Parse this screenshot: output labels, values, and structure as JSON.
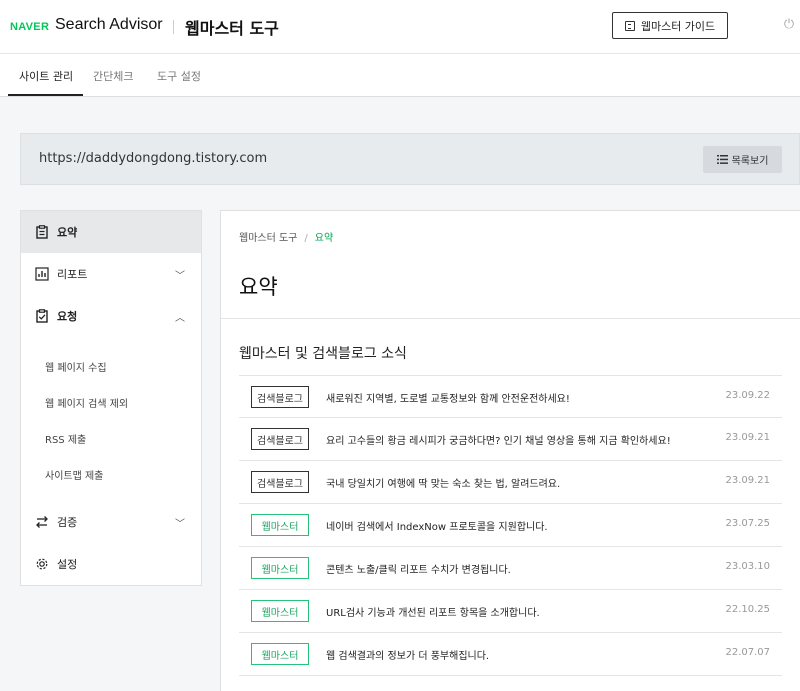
{
  "header": {
    "brand": "NAVER",
    "product": "Search Advisor",
    "tool_title": "웹마스터 도구",
    "guide_button": "웹마스터 가이드",
    "power_icon": "power-icon"
  },
  "tabs": [
    {
      "label": "사이트 관리",
      "active": true
    },
    {
      "label": "간단체크",
      "active": false
    },
    {
      "label": "도구 설정",
      "active": false
    }
  ],
  "site": {
    "url": "https://daddydongdong.tistory.com",
    "list_button": "목록보기"
  },
  "sidebar": {
    "items": [
      {
        "label": "요약",
        "icon": "clipboard-icon",
        "active": true
      },
      {
        "label": "리포트",
        "icon": "bar-chart-icon",
        "chevron": "down"
      },
      {
        "label": "요청",
        "icon": "clipboard-check-icon",
        "chevron": "up"
      },
      {
        "label": "검증",
        "icon": "swap-arrows-icon",
        "chevron": "down"
      },
      {
        "label": "설정",
        "icon": "gear-icon"
      }
    ],
    "sub_items": [
      "웹 페이지 수집",
      "웹 페이지 검색 제외",
      "RSS 제출",
      "사이트맵 제출"
    ]
  },
  "main": {
    "breadcrumb": {
      "root": "웹마스터 도구",
      "sep": "/",
      "current": "요약"
    },
    "title": "요약",
    "news_section_title": "웹마스터 및 검색블로그 소식",
    "news": [
      {
        "badge": "검색블로그",
        "badge_type": "dark",
        "text": "새로워진 지역별, 도로별 교통정보와 함께 안전운전하세요!",
        "date": "23.09.22"
      },
      {
        "badge": "검색블로그",
        "badge_type": "dark",
        "text": "요리 고수들의 황금 레시피가 궁금하다면? 인기 채널 영상을 통해 지금 확인하세요!",
        "date": "23.09.21"
      },
      {
        "badge": "검색블로그",
        "badge_type": "dark",
        "text": "국내 당일치기 여행에 딱 맞는 숙소 찾는 법, 알려드려요.",
        "date": "23.09.21"
      },
      {
        "badge": "웹마스터",
        "badge_type": "green",
        "text": "네이버 검색에서 IndexNow 프로토콜을 지원합니다.",
        "date": "23.07.25"
      },
      {
        "badge": "웹마스터",
        "badge_type": "green",
        "text": "콘텐츠 노출/클릭 리포트 수치가 변경됩니다.",
        "date": "23.03.10"
      },
      {
        "badge": "웹마스터",
        "badge_type": "green",
        "text": "URL검사 기능과 개선된 리포트 항목을 소개합니다.",
        "date": "22.10.25"
      },
      {
        "badge": "웹마스터",
        "badge_type": "green",
        "text": "웹 검색결과의 정보가 더 풍부해집니다.",
        "date": "22.07.07"
      }
    ]
  },
  "colors": {
    "accent": "#03c75a",
    "badge_green": "#27c27a"
  }
}
